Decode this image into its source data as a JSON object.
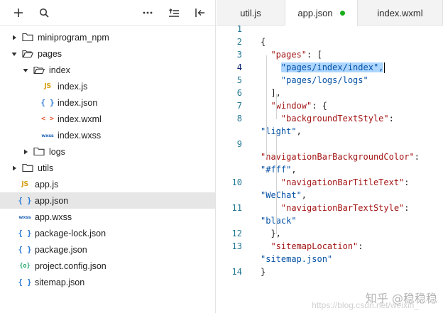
{
  "toolbar": {
    "buttons": [
      {
        "name": "add-icon"
      },
      {
        "name": "search-icon"
      },
      {
        "name": "more-icon"
      },
      {
        "name": "sort-icon"
      },
      {
        "name": "collapse-icon"
      }
    ]
  },
  "tree": [
    {
      "label": "miniprogram_npm",
      "type": "folder",
      "expanded": false,
      "depth": 0
    },
    {
      "label": "pages",
      "type": "folder",
      "expanded": true,
      "depth": 0
    },
    {
      "label": "index",
      "type": "folder",
      "expanded": true,
      "depth": 1
    },
    {
      "label": "index.js",
      "type": "js",
      "depth": 2
    },
    {
      "label": "index.json",
      "type": "json",
      "depth": 2
    },
    {
      "label": "index.wxml",
      "type": "wxml",
      "depth": 2
    },
    {
      "label": "index.wxss",
      "type": "wxss",
      "depth": 2
    },
    {
      "label": "logs",
      "type": "folder",
      "expanded": false,
      "depth": 1
    },
    {
      "label": "utils",
      "type": "folder",
      "expanded": false,
      "depth": 0
    },
    {
      "label": "app.js",
      "type": "js",
      "depth": 0
    },
    {
      "label": "app.json",
      "type": "json",
      "depth": 0,
      "selected": true
    },
    {
      "label": "app.wxss",
      "type": "wxss",
      "depth": 0
    },
    {
      "label": "package-lock.json",
      "type": "json",
      "depth": 0
    },
    {
      "label": "package.json",
      "type": "json",
      "depth": 0
    },
    {
      "label": "project.config.json",
      "type": "config",
      "depth": 0
    },
    {
      "label": "sitemap.json",
      "type": "json",
      "depth": 0
    }
  ],
  "icon_glyphs": {
    "js": "JS",
    "json": "{ }",
    "wxml": "< >",
    "wxss": "wxss",
    "config": "{o}"
  },
  "tabs": [
    {
      "label": "util.js",
      "active": false
    },
    {
      "label": "app.json",
      "active": true,
      "modified": true
    },
    {
      "label": "index.wxml",
      "active": false
    }
  ],
  "code": [
    {
      "num": "1",
      "tokens": []
    },
    {
      "num": "2",
      "tokens": [
        {
          "t": "{",
          "c": "pun"
        }
      ]
    },
    {
      "num": "3",
      "tokens": [
        {
          "t": "  ",
          "c": "pun"
        },
        {
          "t": "\"pages\"",
          "c": "key"
        },
        {
          "t": ": [",
          "c": "pun"
        }
      ]
    },
    {
      "num": "4",
      "current": true,
      "tokens": [
        {
          "t": "    ",
          "c": "pun"
        },
        {
          "t": "\"pages/index/index\",",
          "c": "str",
          "sel": true
        },
        {
          "t": "",
          "c": "caret"
        }
      ]
    },
    {
      "num": "5",
      "tokens": [
        {
          "t": "    ",
          "c": "pun"
        },
        {
          "t": "\"pages/logs/logs\"",
          "c": "str"
        }
      ]
    },
    {
      "num": "6",
      "tokens": [
        {
          "t": "  ],",
          "c": "pun"
        }
      ]
    },
    {
      "num": "7",
      "tokens": [
        {
          "t": "  ",
          "c": "pun"
        },
        {
          "t": "\"window\"",
          "c": "key"
        },
        {
          "t": ": {",
          "c": "pun"
        }
      ]
    },
    {
      "num": "8",
      "tokens": [
        {
          "t": "    ",
          "c": "pun"
        },
        {
          "t": "\"backgroundTextStyle\"",
          "c": "key"
        },
        {
          "t": ":",
          "c": "pun"
        }
      ]
    },
    {
      "num": "",
      "tokens": [
        {
          "t": "\"light\"",
          "c": "str"
        },
        {
          "t": ",",
          "c": "pun"
        }
      ]
    },
    {
      "num": "9",
      "tokens": []
    },
    {
      "num": "",
      "tokens": [
        {
          "t": "\"navigationBarBackgroundColor\"",
          "c": "key"
        },
        {
          "t": ":",
          "c": "pun"
        }
      ]
    },
    {
      "num": "",
      "tokens": [
        {
          "t": "\"#fff\"",
          "c": "str"
        },
        {
          "t": ",",
          "c": "pun"
        }
      ]
    },
    {
      "num": "10",
      "tokens": [
        {
          "t": "    ",
          "c": "pun"
        },
        {
          "t": "\"navigationBarTitleText\"",
          "c": "key"
        },
        {
          "t": ":",
          "c": "pun"
        }
      ]
    },
    {
      "num": "",
      "tokens": [
        {
          "t": "\"WeChat\"",
          "c": "str"
        },
        {
          "t": ",",
          "c": "pun"
        }
      ]
    },
    {
      "num": "11",
      "tokens": [
        {
          "t": "    ",
          "c": "pun"
        },
        {
          "t": "\"navigationBarTextStyle\"",
          "c": "key"
        },
        {
          "t": ":",
          "c": "pun"
        }
      ]
    },
    {
      "num": "",
      "tokens": [
        {
          "t": "\"black\"",
          "c": "str"
        }
      ]
    },
    {
      "num": "12",
      "tokens": [
        {
          "t": "  },",
          "c": "pun"
        }
      ]
    },
    {
      "num": "13",
      "tokens": [
        {
          "t": "  ",
          "c": "pun"
        },
        {
          "t": "\"sitemapLocation\"",
          "c": "key"
        },
        {
          "t": ":",
          "c": "pun"
        }
      ]
    },
    {
      "num": "",
      "tokens": [
        {
          "t": "\"sitemap.json\"",
          "c": "str"
        }
      ]
    },
    {
      "num": "14",
      "tokens": [
        {
          "t": "}",
          "c": "pun"
        }
      ]
    }
  ],
  "watermark": "知乎 @稳稳稳",
  "watermark_url": "https://blog.csdn.net/weixin_"
}
